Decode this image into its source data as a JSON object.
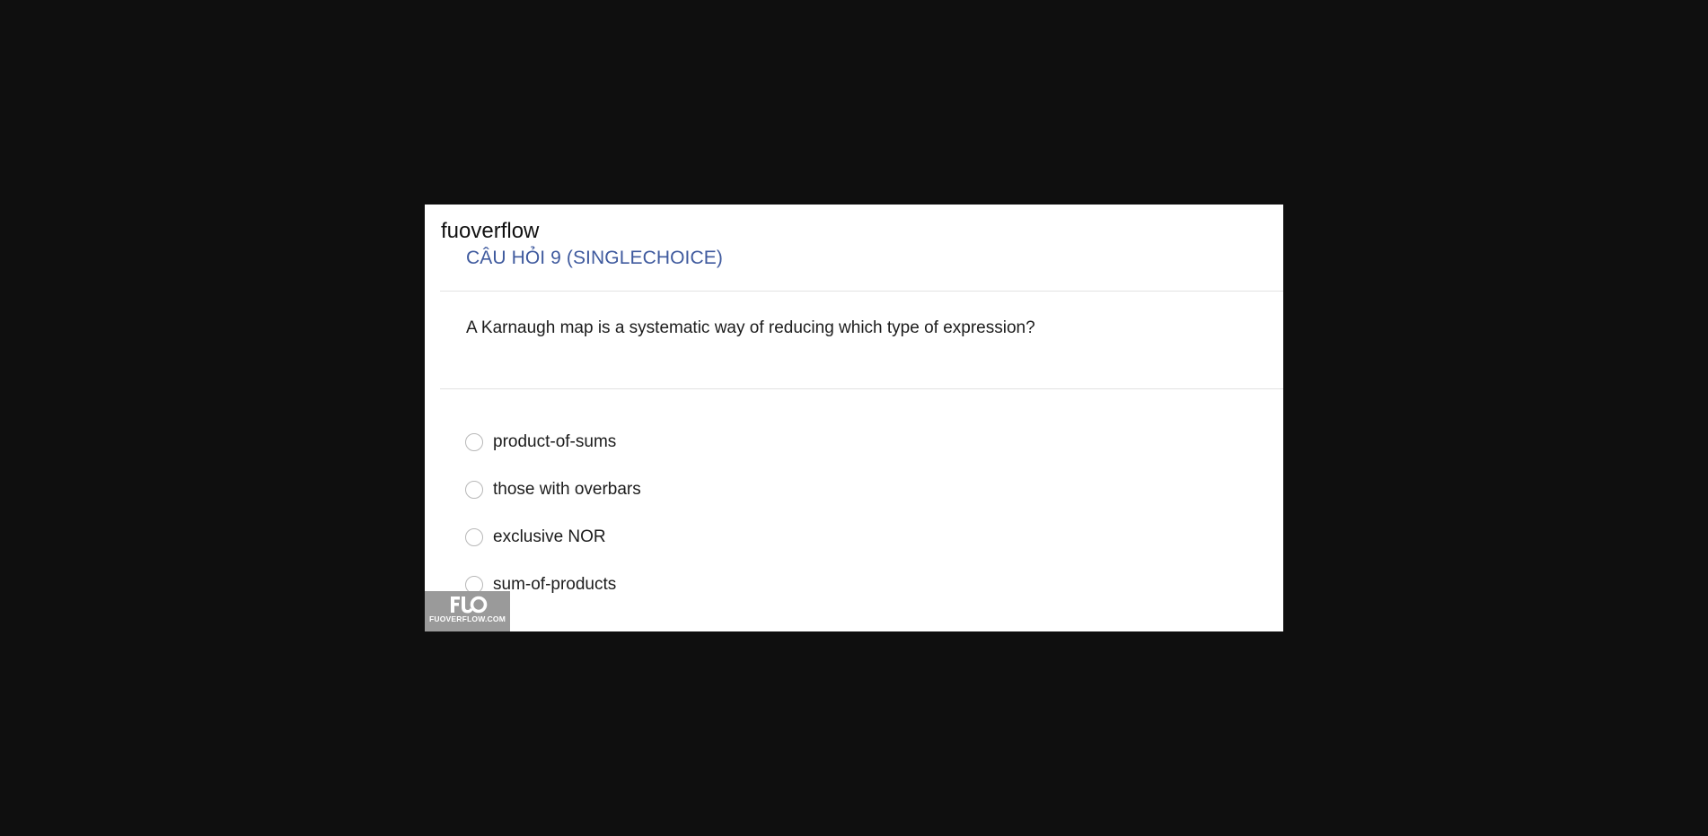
{
  "site": {
    "name": "fuoverflow"
  },
  "question": {
    "title": "CÂU HỎI 9 (SINGLECHOICE)",
    "text": "A Karnaugh map is a systematic way of reducing which type of expression?",
    "options": [
      {
        "label": "product-of-sums",
        "selected": false
      },
      {
        "label": "those with overbars",
        "selected": false
      },
      {
        "label": "exclusive NOR",
        "selected": false
      },
      {
        "label": "sum-of-products",
        "selected": false
      }
    ]
  },
  "watermark": {
    "logo_text": "FUO",
    "domain": "FUOVERFLOW.COM"
  },
  "colors": {
    "background": "#0f0f0f",
    "page": "#ffffff",
    "title_accent": "#3f5a9e",
    "watermark_bg": "#9a9a9a"
  }
}
